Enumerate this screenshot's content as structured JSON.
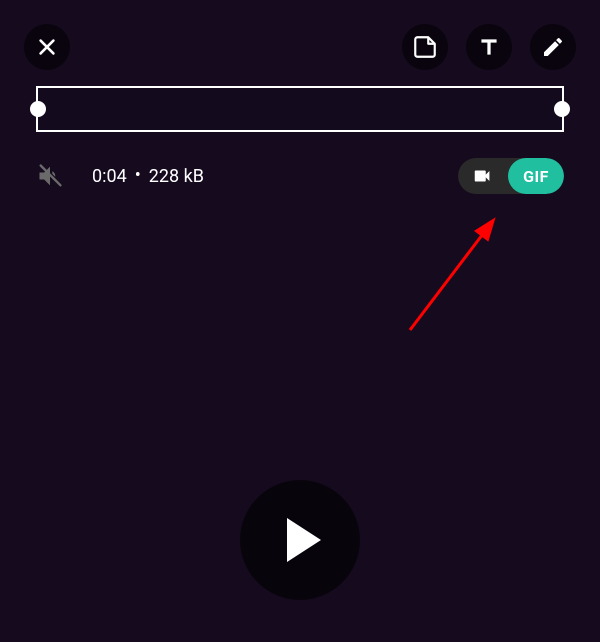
{
  "topbar": {
    "close_icon": "close",
    "sticker_icon": "sticker",
    "text_icon": "text",
    "draw_icon": "pencil"
  },
  "trim": {
    "left_handle": "trim-start",
    "right_handle": "trim-end"
  },
  "info": {
    "mute_icon": "muted",
    "duration": "0:04",
    "separator": "•",
    "filesize": "228 kB"
  },
  "mode_toggle": {
    "video_icon": "video-camera",
    "gif_label": "GIF",
    "active": "gif"
  },
  "play": {
    "icon": "play"
  },
  "annotation": {
    "arrow": "red-arrow-pointing-to-video-toggle"
  },
  "colors": {
    "accent": "#1fbf9f",
    "annotation": "#ff0000"
  }
}
